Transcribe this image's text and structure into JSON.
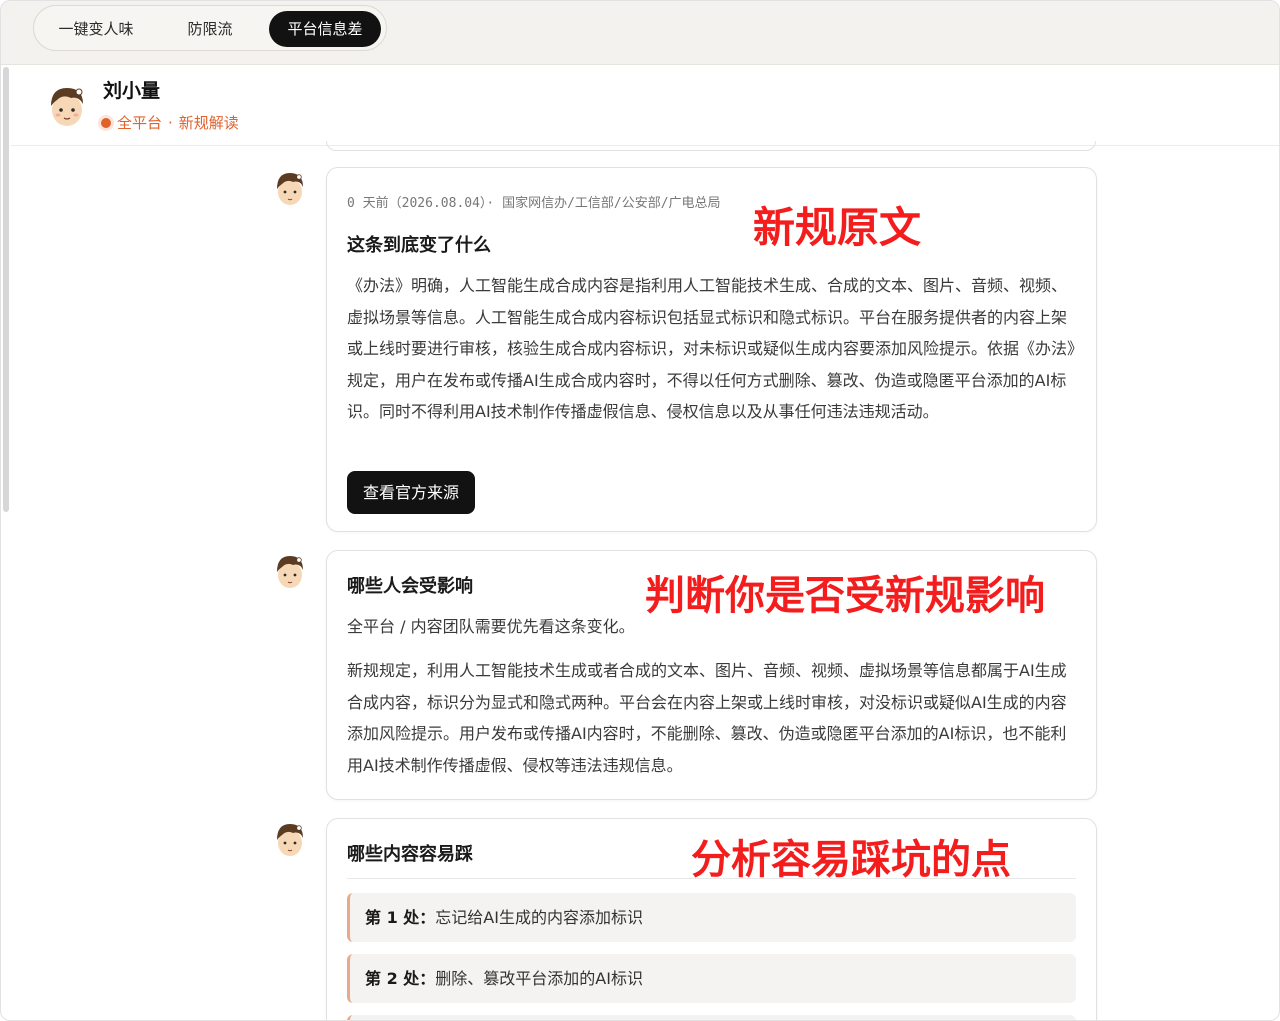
{
  "tabs": [
    {
      "label": "一键变人味",
      "active": false
    },
    {
      "label": "防限流",
      "active": false
    },
    {
      "label": "平台信息差",
      "active": true
    }
  ],
  "profile": {
    "name": "刘小量",
    "platform": "全平台",
    "separator": "·",
    "category": "新规解读"
  },
  "card1": {
    "meta": "0 天前（2026.08.04）· 国家网信办/工信部/公安部/广电总局",
    "title": "这条到底变了什么",
    "body": "《办法》明确，人工智能生成合成内容是指利用人工智能技术生成、合成的文本、图片、音频、视频、虚拟场景等信息。人工智能生成合成内容标识包括显式标识和隐式标识。平台在服务提供者的内容上架或上线时要进行审核，核验生成合成内容标识，对未标识或疑似生成内容要添加风险提示。依据《办法》规定，用户在发布或传播AI生成合成内容时，不得以任何方式删除、篡改、伪造或隐匿平台添加的AI标识。同时不得利用AI技术制作传播虚假信息、侵权信息以及从事任何违法违规活动。",
    "button": "查看官方来源",
    "annotation": "新规原文"
  },
  "card2": {
    "title": "哪些人会受影响",
    "subtitle": "全平台 / 内容团队需要优先看这条变化。",
    "body": "新规规定，利用人工智能技术生成或者合成的文本、图片、音频、视频、虚拟场景等信息都属于AI生成合成内容，标识分为显式和隐式两种。平台会在内容上架或上线时审核，对没标识或疑似AI生成的内容添加风险提示。用户发布或传播AI内容时，不能删除、篡改、伪造或隐匿平台添加的AI标识，也不能利用AI技术制作传播虚假、侵权等违法违规信息。",
    "annotation": "判断你是否受新规影响"
  },
  "card3": {
    "title": "哪些内容容易踩",
    "annotation": "分析容易踩坑的点",
    "items": [
      {
        "prefix": "第 1 处：",
        "text": "忘记给AI生成的内容添加标识"
      },
      {
        "prefix": "第 2 处：",
        "text": "删除、篡改平台添加的AI标识"
      }
    ]
  },
  "colors": {
    "accent": "#e0622d",
    "annotation": "#f41d1d",
    "dark": "#121212",
    "risk_border": "#e9a98a"
  }
}
